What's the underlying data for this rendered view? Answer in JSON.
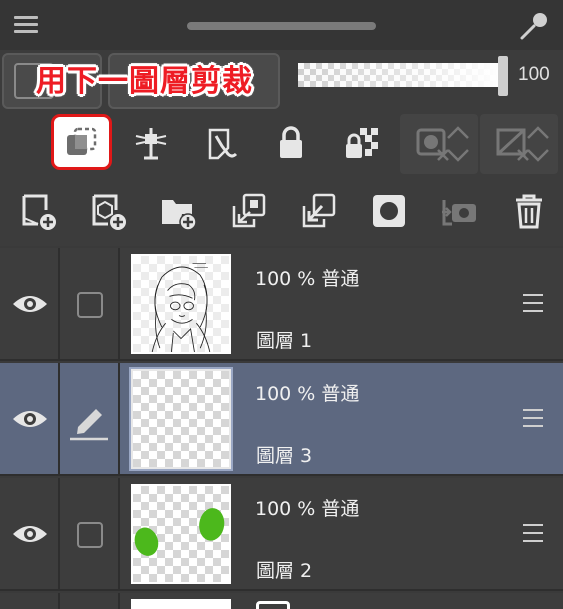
{
  "header": {
    "menu_icon": "hamburger-icon",
    "drag_handle": "grab-bar",
    "tool_icon": "eyedropper-icon"
  },
  "blend": {
    "callout_text": "用下一圖層剪裁",
    "callout_color": "#ee1c24",
    "opacity_value": "100"
  },
  "toolbar_row1": [
    {
      "icon": "clip-to-layer-below-icon",
      "highlighted": true
    },
    {
      "icon": "reference-layer-icon"
    },
    {
      "icon": "draft-layer-icon"
    },
    {
      "icon": "lock-icon"
    },
    {
      "icon": "lock-transparent-pixels-icon"
    },
    {
      "icon": "mask-icon"
    },
    {
      "icon": "tone-icon"
    }
  ],
  "toolbar_row2": [
    {
      "icon": "new-raster-layer-icon"
    },
    {
      "icon": "new-vector-layer-icon"
    },
    {
      "icon": "new-folder-icon"
    },
    {
      "icon": "transfer-to-lower-layer-icon"
    },
    {
      "icon": "combine-with-lower-layer-icon"
    },
    {
      "icon": "layer-mask-icon"
    },
    {
      "icon": "layer-color-icon"
    },
    {
      "icon": "delete-layer-icon"
    }
  ],
  "layers": [
    {
      "opacity_blend": "100 % 普通",
      "name": "圖層 1",
      "selected": false,
      "active_tool": "none",
      "thumbnail": "line-art"
    },
    {
      "opacity_blend": "100 % 普通",
      "name": "圖層 3",
      "selected": true,
      "active_tool": "pencil",
      "thumbnail": "empty"
    },
    {
      "opacity_blend": "100 % 普通",
      "name": "圖層 2",
      "selected": false,
      "active_tool": "none",
      "thumbnail": "green-blobs"
    }
  ],
  "colors": {
    "highlight_border": "#e01818",
    "selected_row": "#5d6880",
    "paint_green": "#4cb81c"
  }
}
